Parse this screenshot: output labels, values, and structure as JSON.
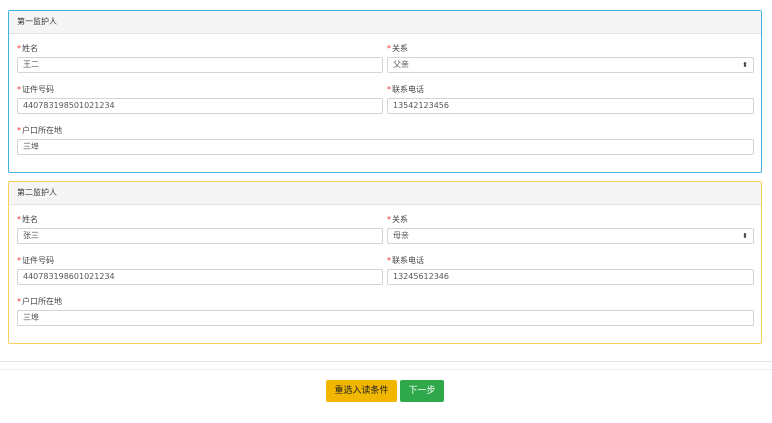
{
  "guardian1": {
    "title": "第一监护人",
    "name_label": "姓名",
    "name_value": "王二",
    "relation_label": "关系",
    "relation_value": "父亲",
    "id_label": "证件号码",
    "id_value": "440783198501021234",
    "phone_label": "联系电话",
    "phone_value": "13542123456",
    "hukou_label": "户口所在地",
    "hukou_value": "三埠"
  },
  "guardian2": {
    "title": "第二监护人",
    "name_label": "姓名",
    "name_value": "张三",
    "relation_label": "关系",
    "relation_value": "母亲",
    "id_label": "证件号码",
    "id_value": "440783198601021234",
    "phone_label": "联系电话",
    "phone_value": "13245612346",
    "hukou_label": "户口所在地",
    "hukou_value": "三埠"
  },
  "required_mark": "*",
  "select_caret": "⬍",
  "buttons": {
    "reset_label": "重选入读条件",
    "next_label": "下一步"
  },
  "colors": {
    "panel1_border": "#43aee0",
    "panel2_border": "#f5d35a",
    "reset_button": "#f1b700",
    "next_button": "#2ea84a",
    "required": "#e33333"
  }
}
